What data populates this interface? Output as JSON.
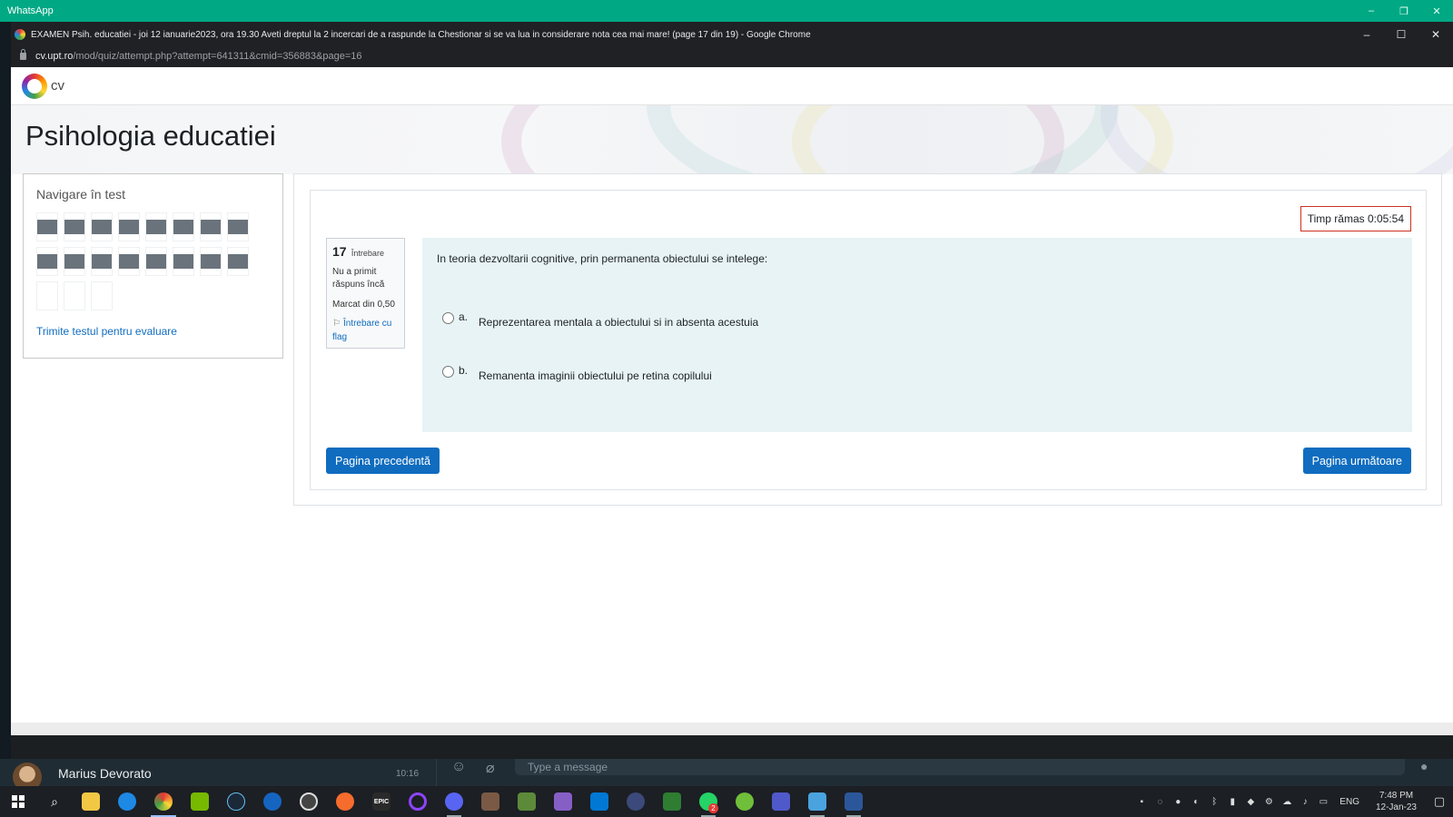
{
  "whatsapp": {
    "title": "WhatsApp",
    "controls": [
      "–",
      "❐",
      "✕"
    ],
    "chat": {
      "contact_name": "Marius Devorato",
      "time": "10:16",
      "message_placeholder": "Type a message"
    }
  },
  "browser": {
    "window_title": "EXAMEN Psih. educatiei - joi 12 ianuarie2023, ora 19.30 Aveti dreptul la 2 incercari de a raspunde la Chestionar si se va lua in considerare nota cea mai mare! (page 17 din 19) - Google Chrome",
    "controls": [
      "–",
      "☐",
      "✕"
    ],
    "url_host": "cv.upt.ro",
    "url_path": "/mod/quiz/attempt.php?attempt=641311&cmid=356883&page=16"
  },
  "site": {
    "logo_text": "cv",
    "page_title": "Psihologia educatiei"
  },
  "quiz_nav": {
    "heading": "Navigare în test",
    "submit_link": "Trimite testul pentru evaluare"
  },
  "timer": {
    "text": "Timp rămas 0:05:54"
  },
  "question": {
    "number": "17",
    "number_label": "Întrebare",
    "state": "Nu a primit răspuns încă",
    "grade": "Marcat din 0,50",
    "flag_label": "Întrebare cu flag",
    "text": "In teoria dezvoltarii cognitive, prin permanenta obiectului se intelege:",
    "answers": [
      {
        "letter": "a.",
        "text": "Reprezentarea mentala a obiectului si in absenta acestuia"
      },
      {
        "letter": "b.",
        "text": "Remanenta imaginii obiectului pe retina copilului"
      }
    ]
  },
  "buttons": {
    "prev": "Pagina precedentă",
    "next": "Pagina următoare"
  },
  "taskbar": {
    "apps": [
      "search-icon",
      "file-explorer-icon",
      "edge-icon",
      "chrome-icon",
      "nvidia-icon",
      "steam-icon",
      "app-store-icon",
      "obs-icon",
      "origin-icon",
      "epic-games-icon",
      "cortana-icon",
      "discord-icon",
      "game-icon",
      "minecraft-icon",
      "visual-studio-icon",
      "vscode-icon",
      "app-icon",
      "word-w-icon",
      "whatsapp-icon",
      "utorrent-icon",
      "teams-icon",
      "photos-icon",
      "word-icon"
    ],
    "epic_label": "EPIC",
    "whatsapp_badge": "2",
    "lang": "ENG",
    "time": "7:48 PM",
    "date": "12-Jan-23"
  }
}
